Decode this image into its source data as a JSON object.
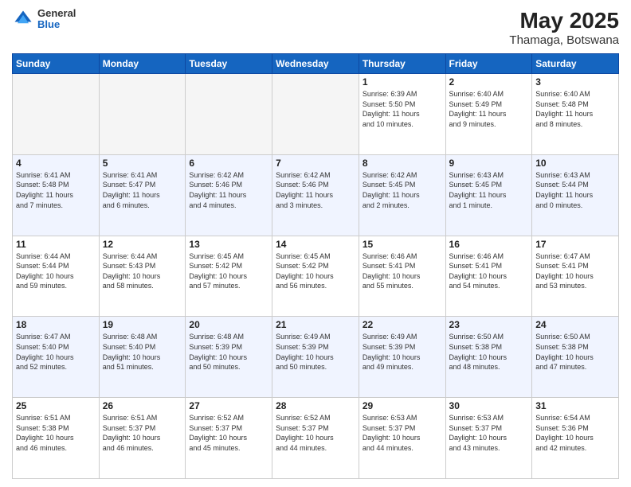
{
  "header": {
    "logo_general": "General",
    "logo_blue": "Blue",
    "month": "May 2025",
    "location": "Thamaga, Botswana"
  },
  "weekdays": [
    "Sunday",
    "Monday",
    "Tuesday",
    "Wednesday",
    "Thursday",
    "Friday",
    "Saturday"
  ],
  "weeks": [
    [
      {
        "day": "",
        "info": ""
      },
      {
        "day": "",
        "info": ""
      },
      {
        "day": "",
        "info": ""
      },
      {
        "day": "",
        "info": ""
      },
      {
        "day": "1",
        "info": "Sunrise: 6:39 AM\nSunset: 5:50 PM\nDaylight: 11 hours\nand 10 minutes."
      },
      {
        "day": "2",
        "info": "Sunrise: 6:40 AM\nSunset: 5:49 PM\nDaylight: 11 hours\nand 9 minutes."
      },
      {
        "day": "3",
        "info": "Sunrise: 6:40 AM\nSunset: 5:48 PM\nDaylight: 11 hours\nand 8 minutes."
      }
    ],
    [
      {
        "day": "4",
        "info": "Sunrise: 6:41 AM\nSunset: 5:48 PM\nDaylight: 11 hours\nand 7 minutes."
      },
      {
        "day": "5",
        "info": "Sunrise: 6:41 AM\nSunset: 5:47 PM\nDaylight: 11 hours\nand 6 minutes."
      },
      {
        "day": "6",
        "info": "Sunrise: 6:42 AM\nSunset: 5:46 PM\nDaylight: 11 hours\nand 4 minutes."
      },
      {
        "day": "7",
        "info": "Sunrise: 6:42 AM\nSunset: 5:46 PM\nDaylight: 11 hours\nand 3 minutes."
      },
      {
        "day": "8",
        "info": "Sunrise: 6:42 AM\nSunset: 5:45 PM\nDaylight: 11 hours\nand 2 minutes."
      },
      {
        "day": "9",
        "info": "Sunrise: 6:43 AM\nSunset: 5:45 PM\nDaylight: 11 hours\nand 1 minute."
      },
      {
        "day": "10",
        "info": "Sunrise: 6:43 AM\nSunset: 5:44 PM\nDaylight: 11 hours\nand 0 minutes."
      }
    ],
    [
      {
        "day": "11",
        "info": "Sunrise: 6:44 AM\nSunset: 5:44 PM\nDaylight: 10 hours\nand 59 minutes."
      },
      {
        "day": "12",
        "info": "Sunrise: 6:44 AM\nSunset: 5:43 PM\nDaylight: 10 hours\nand 58 minutes."
      },
      {
        "day": "13",
        "info": "Sunrise: 6:45 AM\nSunset: 5:42 PM\nDaylight: 10 hours\nand 57 minutes."
      },
      {
        "day": "14",
        "info": "Sunrise: 6:45 AM\nSunset: 5:42 PM\nDaylight: 10 hours\nand 56 minutes."
      },
      {
        "day": "15",
        "info": "Sunrise: 6:46 AM\nSunset: 5:41 PM\nDaylight: 10 hours\nand 55 minutes."
      },
      {
        "day": "16",
        "info": "Sunrise: 6:46 AM\nSunset: 5:41 PM\nDaylight: 10 hours\nand 54 minutes."
      },
      {
        "day": "17",
        "info": "Sunrise: 6:47 AM\nSunset: 5:41 PM\nDaylight: 10 hours\nand 53 minutes."
      }
    ],
    [
      {
        "day": "18",
        "info": "Sunrise: 6:47 AM\nSunset: 5:40 PM\nDaylight: 10 hours\nand 52 minutes."
      },
      {
        "day": "19",
        "info": "Sunrise: 6:48 AM\nSunset: 5:40 PM\nDaylight: 10 hours\nand 51 minutes."
      },
      {
        "day": "20",
        "info": "Sunrise: 6:48 AM\nSunset: 5:39 PM\nDaylight: 10 hours\nand 50 minutes."
      },
      {
        "day": "21",
        "info": "Sunrise: 6:49 AM\nSunset: 5:39 PM\nDaylight: 10 hours\nand 50 minutes."
      },
      {
        "day": "22",
        "info": "Sunrise: 6:49 AM\nSunset: 5:39 PM\nDaylight: 10 hours\nand 49 minutes."
      },
      {
        "day": "23",
        "info": "Sunrise: 6:50 AM\nSunset: 5:38 PM\nDaylight: 10 hours\nand 48 minutes."
      },
      {
        "day": "24",
        "info": "Sunrise: 6:50 AM\nSunset: 5:38 PM\nDaylight: 10 hours\nand 47 minutes."
      }
    ],
    [
      {
        "day": "25",
        "info": "Sunrise: 6:51 AM\nSunset: 5:38 PM\nDaylight: 10 hours\nand 46 minutes."
      },
      {
        "day": "26",
        "info": "Sunrise: 6:51 AM\nSunset: 5:37 PM\nDaylight: 10 hours\nand 46 minutes."
      },
      {
        "day": "27",
        "info": "Sunrise: 6:52 AM\nSunset: 5:37 PM\nDaylight: 10 hours\nand 45 minutes."
      },
      {
        "day": "28",
        "info": "Sunrise: 6:52 AM\nSunset: 5:37 PM\nDaylight: 10 hours\nand 44 minutes."
      },
      {
        "day": "29",
        "info": "Sunrise: 6:53 AM\nSunset: 5:37 PM\nDaylight: 10 hours\nand 44 minutes."
      },
      {
        "day": "30",
        "info": "Sunrise: 6:53 AM\nSunset: 5:37 PM\nDaylight: 10 hours\nand 43 minutes."
      },
      {
        "day": "31",
        "info": "Sunrise: 6:54 AM\nSunset: 5:36 PM\nDaylight: 10 hours\nand 42 minutes."
      }
    ]
  ]
}
